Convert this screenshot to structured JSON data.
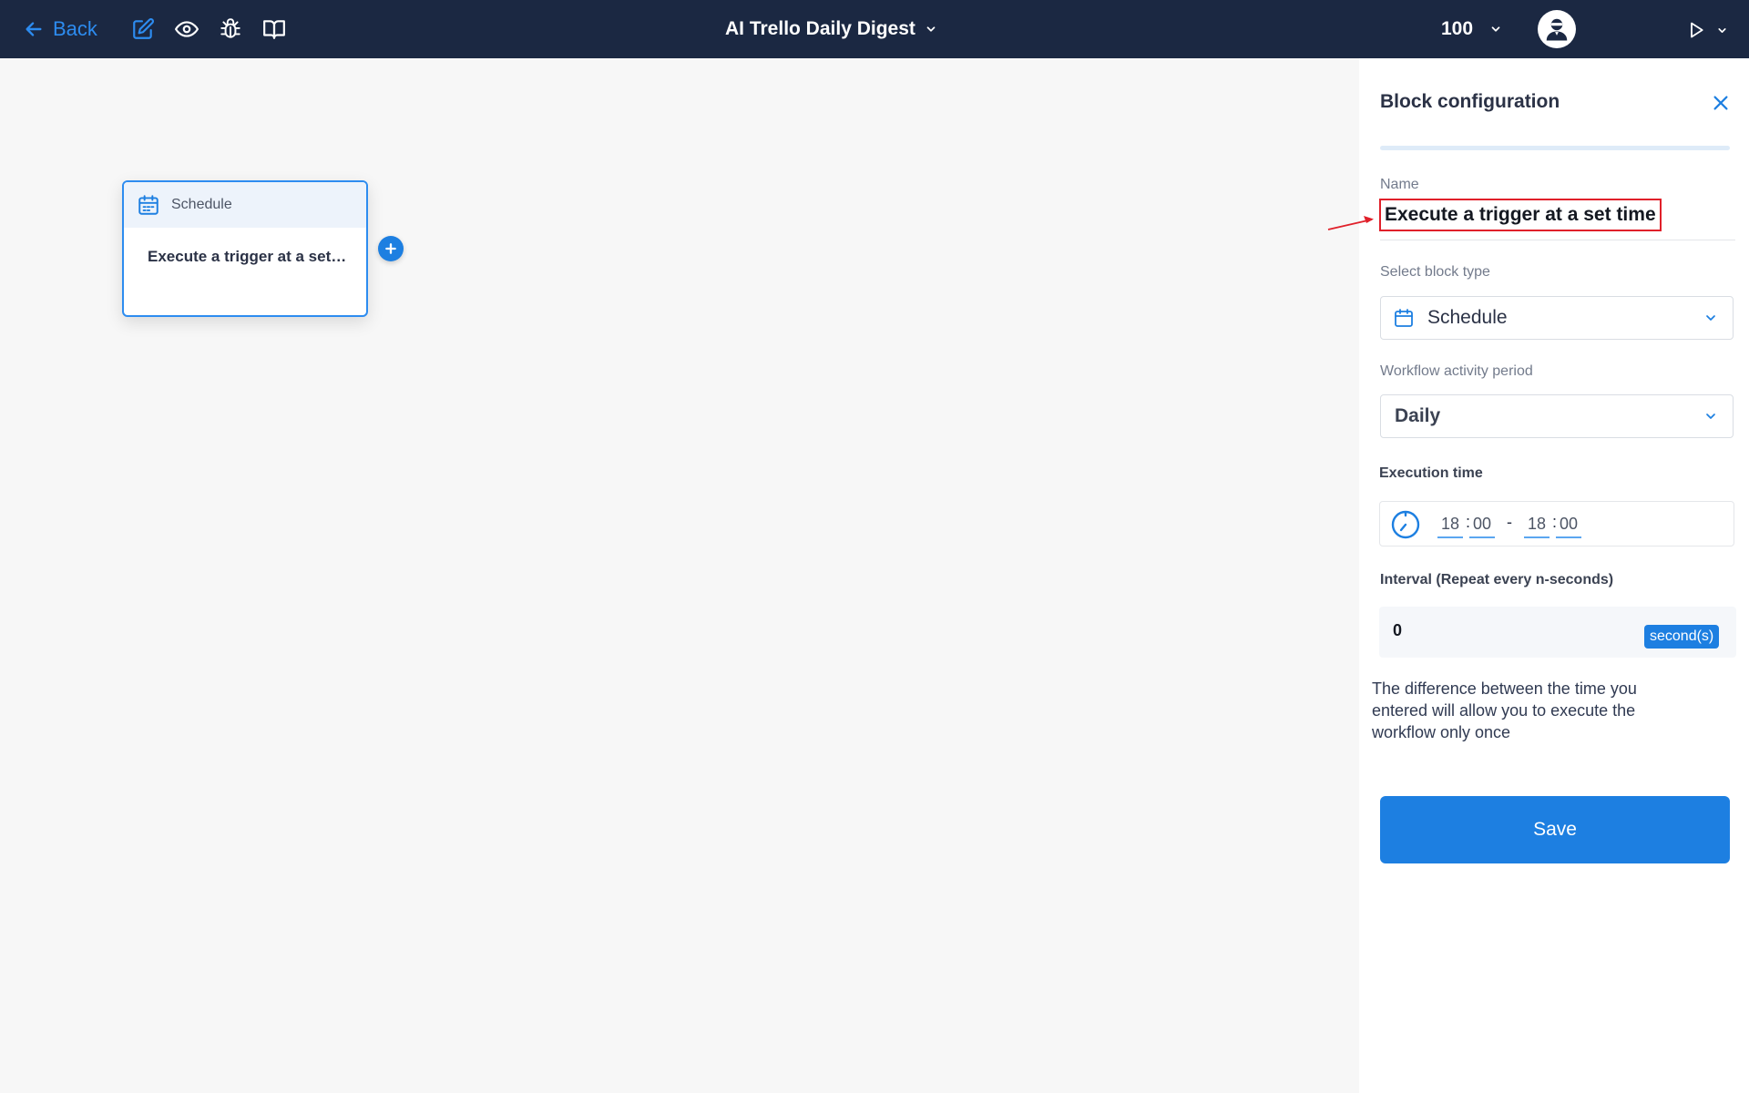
{
  "topbar": {
    "back_label": "Back",
    "title": "AI Trello Daily Digest",
    "zoom": "100",
    "icons": [
      "edit-icon",
      "eye-icon",
      "bug-icon",
      "book-icon"
    ]
  },
  "canvas": {
    "node": {
      "type_label": "Schedule",
      "name": "Execute a trigger at a set time"
    }
  },
  "panel": {
    "title": "Block configuration",
    "name_label": "Name",
    "name_value": "Execute a trigger at a set time",
    "block_type_label": "Select block type",
    "block_type_value": "Schedule",
    "period_label": "Workflow activity period",
    "period_value": "Daily",
    "exec_time_label": "Execution time",
    "start_hour": "18",
    "start_minute": "00",
    "end_hour": "18",
    "end_minute": "00",
    "time_sep": ":",
    "range_sep": "-",
    "interval_label": "Interval (Repeat every n-seconds)",
    "interval_value": "0",
    "interval_unit": "second(s)",
    "note": "The difference between the time you entered will allow you to execute the workflow only once",
    "save_label": "Save"
  },
  "colors": {
    "topbar_bg": "#1b2842",
    "accent": "#1d7fe1",
    "highlight": "#e0202a"
  }
}
